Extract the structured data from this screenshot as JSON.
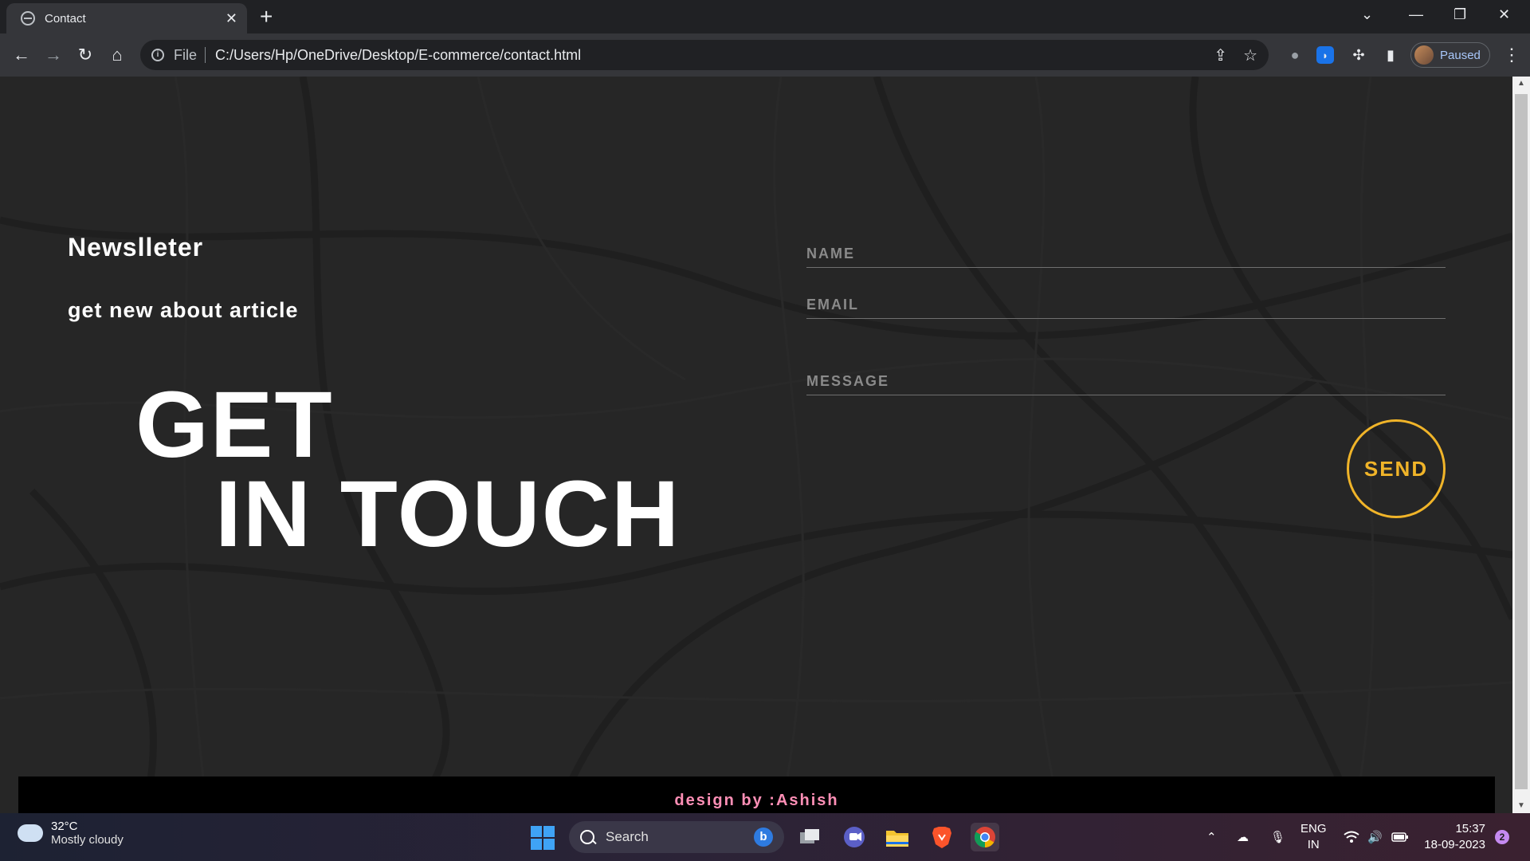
{
  "browser": {
    "tab_title": "Contact",
    "url_scheme": "File",
    "url": "C:/Users/Hp/OneDrive/Desktop/E-commerce/contact.html",
    "profile_label": "Paused"
  },
  "page": {
    "newsletter_title": "Newslleter",
    "newsletter_subtitle": "get new about article",
    "headline_line1": "GET",
    "headline_line2": "IN TOUCH",
    "form": {
      "name_placeholder": "NAME",
      "email_placeholder": "EMAIL",
      "message_placeholder": "MESSAGE",
      "send_label": "SEND"
    },
    "footer_text": "design by :Ashish",
    "colors": {
      "accent": "#f0b429",
      "footer_text": "#ff8fb6",
      "background": "#262626"
    }
  },
  "taskbar": {
    "weather_temp": "32°C",
    "weather_desc": "Mostly cloudy",
    "search_label": "Search",
    "lang_line1": "ENG",
    "lang_line2": "IN",
    "time": "15:37",
    "date": "18-09-2023",
    "notification_count": "2"
  }
}
